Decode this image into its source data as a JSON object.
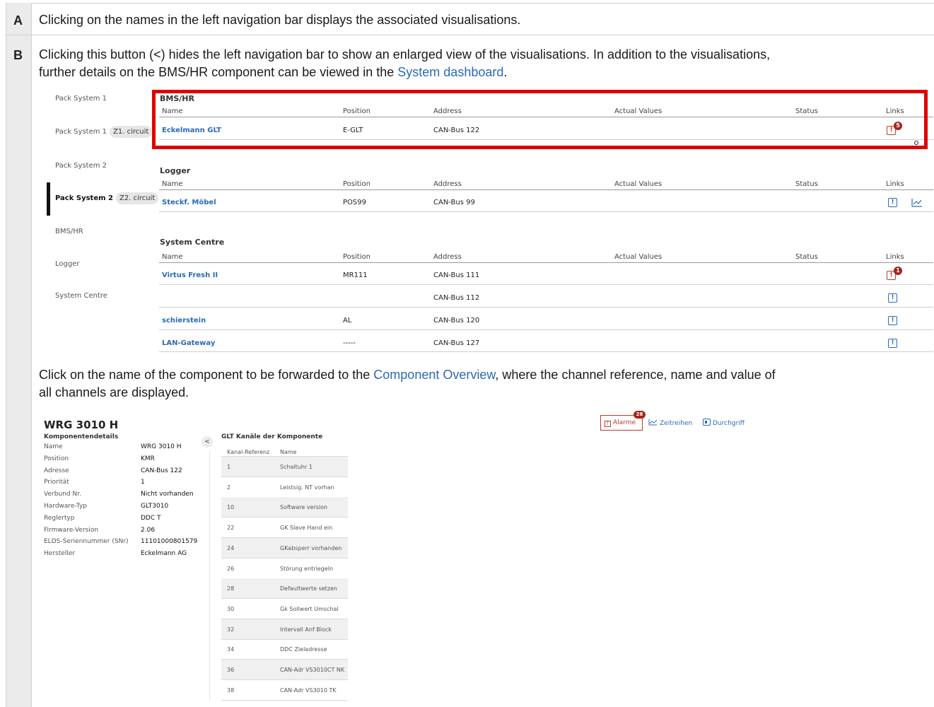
{
  "rows": [
    {
      "letter": "A",
      "text": "Clicking on the names in the left navigation bar displays the associated visualisations."
    },
    {
      "letter": "B",
      "text_line1": "Clicking this button (<) hides the left navigation bar to show an enlarged view of the visualisations. In addition to the visualisations,",
      "text_line2_pre": "further details on the BMS/HR component can be viewed in the ",
      "text_line2_link": "System dashboard",
      "text_line2_post": "."
    }
  ],
  "nav": {
    "items": [
      {
        "label": "Pack System 1"
      },
      {
        "label": "Pack System 1",
        "chip": "Z1. circuit"
      },
      {
        "label": "Pack System 2"
      },
      {
        "label": "Pack System 2",
        "chip": "Z2. circuit",
        "active": true
      },
      {
        "label": "BMS/HR"
      },
      {
        "label": "Logger"
      },
      {
        "label": "System Centre"
      }
    ]
  },
  "columns": {
    "name": "Name",
    "position": "Position",
    "address": "Address",
    "actual": "Actual Values",
    "status": "Status",
    "links": "Links"
  },
  "sections": [
    {
      "title": "BMS/HR",
      "rows": [
        {
          "name": "Eckelmann GLT",
          "position": "E-GLT",
          "address": "CAN-Bus 122",
          "alarm_badge": "5"
        }
      ]
    },
    {
      "title": "Logger",
      "rows": [
        {
          "name": "Steckf. Möbel",
          "position": "POS99",
          "address": "CAN-Bus 99",
          "trend": true
        }
      ]
    },
    {
      "title": "System Centre",
      "rows": [
        {
          "name": "Virtus Fresh II",
          "position": "MR111",
          "address": "CAN-Bus 111",
          "alarm_badge": "1"
        },
        {
          "name": "",
          "position": "",
          "address": "CAN-Bus 112"
        },
        {
          "name": "schierstein",
          "position": "AL",
          "address": "CAN-Bus 120"
        },
        {
          "name": "LAN-Gateway",
          "position": "-----",
          "address": "CAN-Bus 127"
        }
      ]
    }
  ],
  "caption": {
    "line1_pre": "Click on the name of the component to be forwarded to the ",
    "line1_link": "Component Overview",
    "line1_post": ", where the channel reference, name and value of",
    "line2": "all channels are displayed."
  },
  "component": {
    "title": "WRG 3010 H",
    "details_title": "Komponentendetails",
    "details": [
      {
        "label": "Name",
        "value": "WRG 3010 H"
      },
      {
        "label": "Position",
        "value": "KMR"
      },
      {
        "label": "Adresse",
        "value": "CAN-Bus 122"
      },
      {
        "label": "Priorität",
        "value": "1"
      },
      {
        "label": "Verbund Nr.",
        "value": "Nicht vorhanden"
      },
      {
        "label": "Hardware-Typ",
        "value": "GLT3010"
      },
      {
        "label": "Reglertyp",
        "value": "DDC T"
      },
      {
        "label": "Firmware-Version",
        "value": "2.06"
      },
      {
        "label": "ELDS-Seriennummer (SNr)",
        "value": "11101000801579"
      },
      {
        "label": "Hersteller",
        "value": "Eckelmann AG"
      }
    ],
    "collapse_glyph": "<",
    "channels_title": "GLT Kanäle der Komponente",
    "channels_headers": {
      "ref": "Kanal-Referenz",
      "name": "Name"
    },
    "channels": [
      {
        "ref": "1",
        "name": "Schaltuhr 1"
      },
      {
        "ref": "2",
        "name": "Leistsig. NT vorhan"
      },
      {
        "ref": "10",
        "name": "Software version"
      },
      {
        "ref": "22",
        "name": "GK Slave Hand ein"
      },
      {
        "ref": "24",
        "name": "GKabsperr vorhanden"
      },
      {
        "ref": "26",
        "name": "Störung entriegeln"
      },
      {
        "ref": "28",
        "name": "Defaultwerte setzen"
      },
      {
        "ref": "30",
        "name": "Gk Sollwert Umschal"
      },
      {
        "ref": "32",
        "name": "Intervall Anf Block"
      },
      {
        "ref": "34",
        "name": "DDC Zieladresse"
      },
      {
        "ref": "36",
        "name": "CAN-Adr VS3010CT NK"
      },
      {
        "ref": "38",
        "name": "CAN-Adr VS3010 TK"
      }
    ],
    "toolbar": {
      "alarme": "Alarme",
      "alarme_badge": "28",
      "zeitreihen": "Zeitreihen",
      "durchgriff": "Durchgriff"
    }
  },
  "colors": {
    "accent": "#2a6ab8",
    "alarm": "#c0392b",
    "highlight": "#e00000"
  },
  "icons": [
    "alarm-icon",
    "trend-icon",
    "chevron-left-icon",
    "grid-icon"
  ]
}
